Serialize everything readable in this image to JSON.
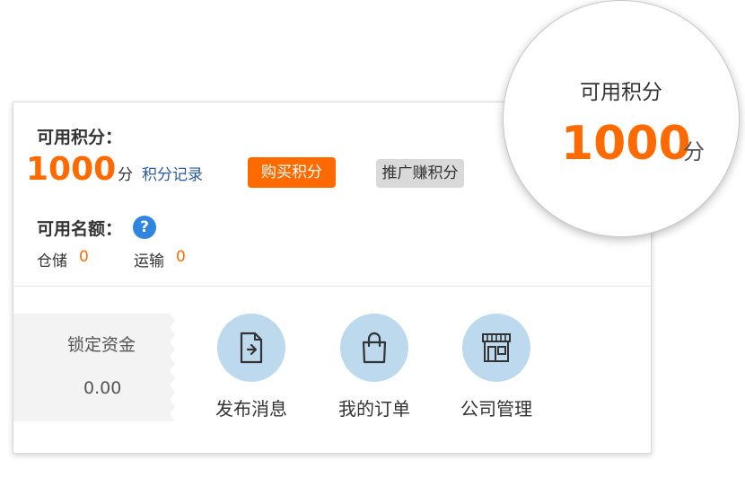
{
  "points": {
    "label": "可用积分：",
    "value": "1000",
    "unit": "分",
    "record_link": "积分记录",
    "buy_button": "购买积分",
    "promote_button": "推广赚积分"
  },
  "quota": {
    "label": "可用名额：",
    "help_icon": "?",
    "items": [
      {
        "label": "仓储",
        "value": "0"
      },
      {
        "label": "运输",
        "value": "0"
      }
    ]
  },
  "locked_funds": {
    "label": "锁定资金",
    "value": "0.00"
  },
  "quick_actions": [
    {
      "label": "发布消息",
      "icon": "publish-icon"
    },
    {
      "label": "我的订单",
      "icon": "shopping-bag-icon"
    },
    {
      "label": "公司管理",
      "icon": "storefront-icon"
    }
  ],
  "magnifier": {
    "label": "可用积分",
    "value": "1000",
    "unit": "分"
  },
  "colors": {
    "accent": "#ff6a00",
    "link": "#2a5b9c",
    "icon_circle": "#bcd9ee",
    "help_blue": "#2f86e0"
  }
}
